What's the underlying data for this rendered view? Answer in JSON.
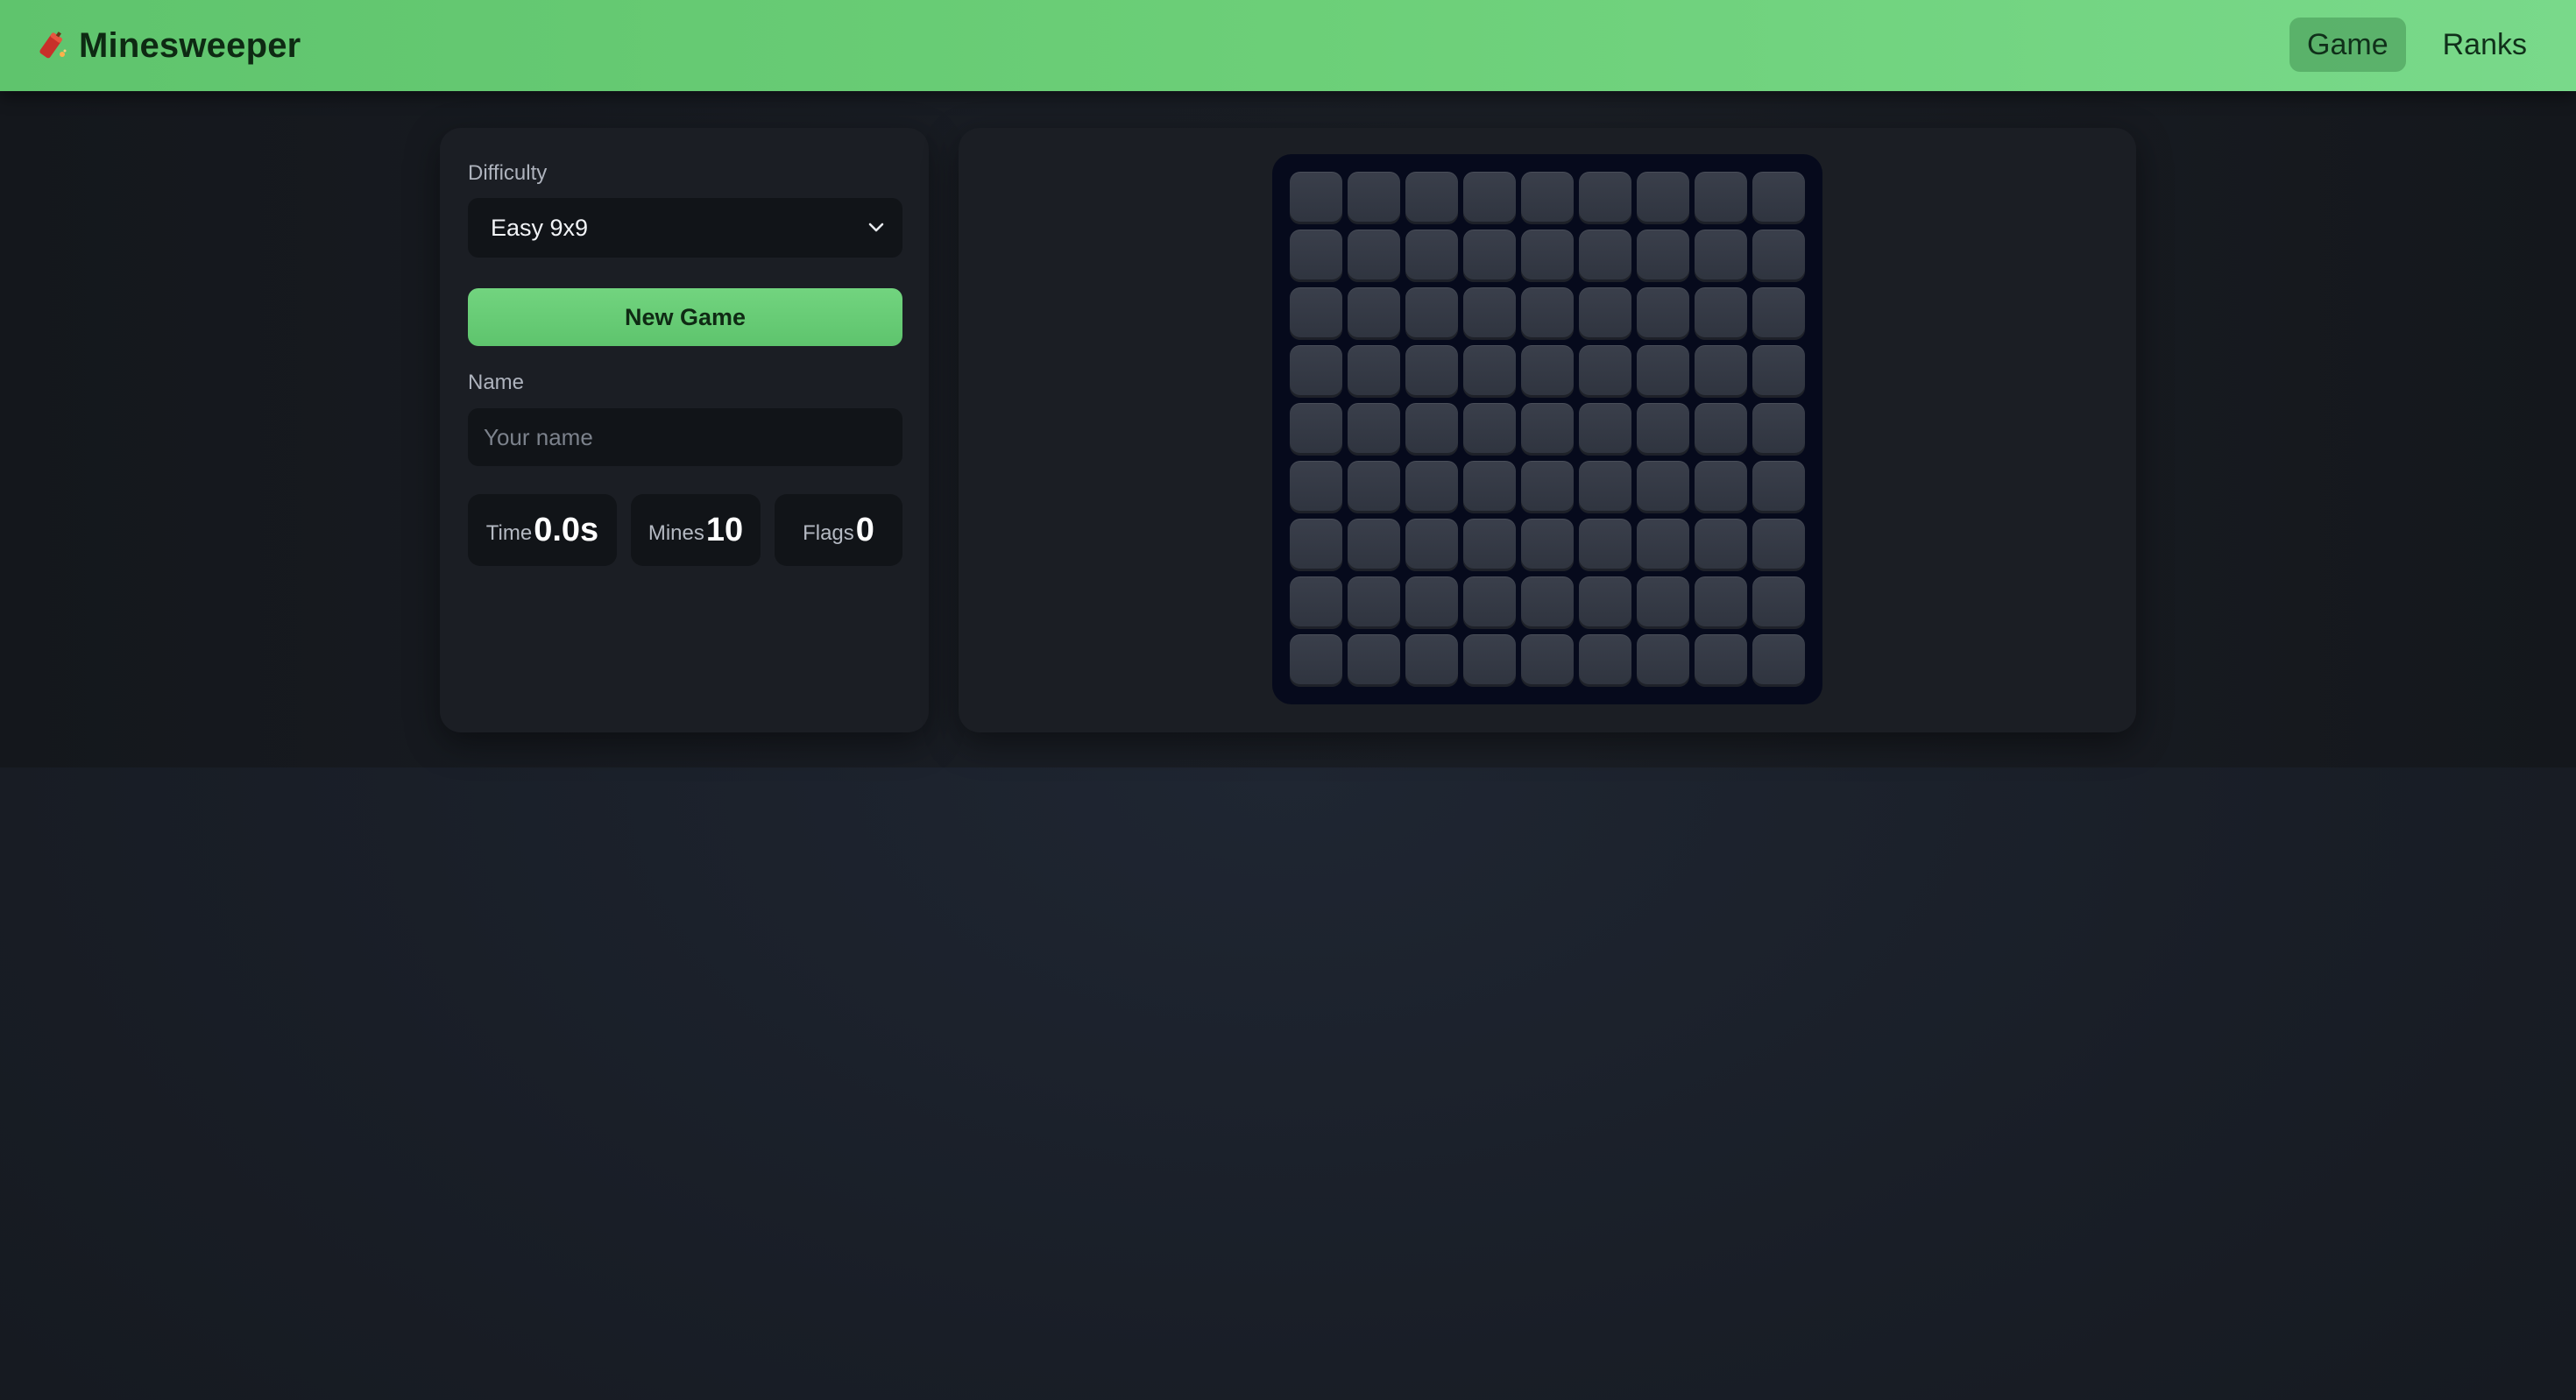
{
  "header": {
    "title": "Minesweeper",
    "logo_icon": "firecracker-icon",
    "nav": [
      {
        "label": "Game",
        "active": true
      },
      {
        "label": "Ranks",
        "active": false
      }
    ]
  },
  "controls": {
    "difficulty_label": "Difficulty",
    "difficulty_selected": "Easy 9x9",
    "new_game_label": "New Game",
    "name_label": "Name",
    "name_value": "",
    "name_placeholder": "Your name"
  },
  "stats": {
    "time_label": "Time",
    "time_value": "0.0s",
    "mines_label": "Mines",
    "mines_value": "10",
    "flags_label": "Flags",
    "flags_value": "0"
  },
  "board": {
    "rows": 9,
    "cols": 9,
    "state": "all-covered"
  },
  "colors": {
    "accent": "#6ccf78",
    "panel": "#1b1e24",
    "board_bg": "#060a1c",
    "cell": "#353a45"
  }
}
